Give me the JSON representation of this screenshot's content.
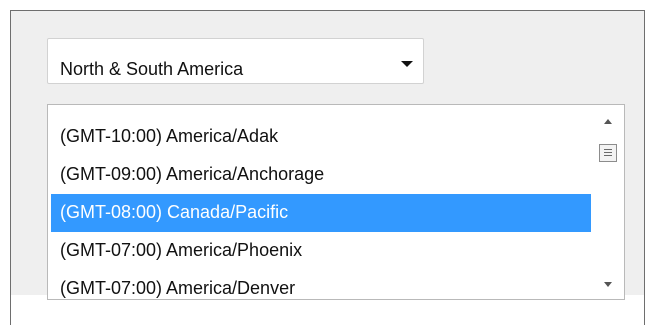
{
  "region_select": {
    "selected_value": "North & South America",
    "icon": "chevron-down-icon"
  },
  "timezone_list": {
    "items": [
      {
        "label": "(GMT-10:00) America/Adak",
        "selected": false
      },
      {
        "label": "(GMT-09:00) America/Anchorage",
        "selected": false
      },
      {
        "label": "(GMT-08:00) Canada/Pacific",
        "selected": true
      },
      {
        "label": "(GMT-07:00) America/Phoenix",
        "selected": false
      },
      {
        "label": "(GMT-07:00) America/Denver",
        "selected": false
      }
    ],
    "selection_color": "#3399ff",
    "scrollbar": {
      "up_icon": "scroll-up-arrow-icon",
      "thumb_icon": "scroll-thumb-grip-icon",
      "down_icon": "scroll-down-arrow-icon"
    }
  }
}
